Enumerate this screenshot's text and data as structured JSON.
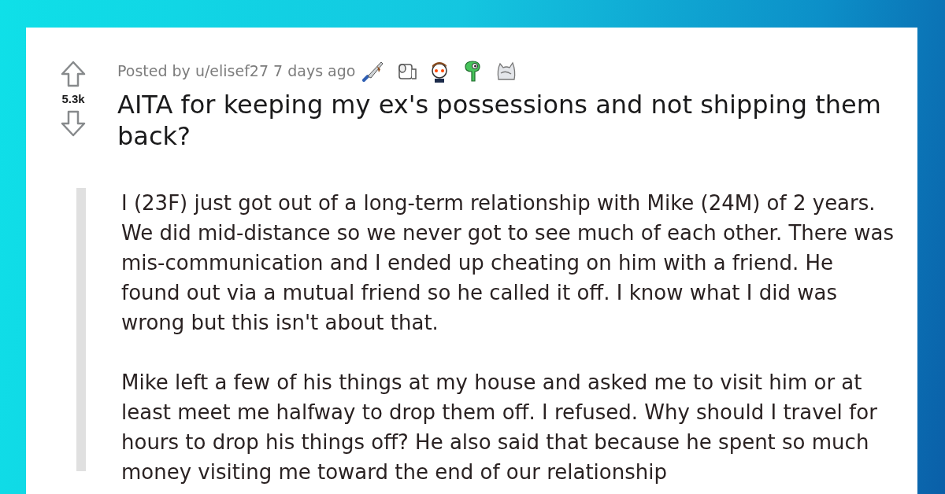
{
  "post": {
    "score": "5.3k",
    "meta": "Posted by u/elisef27 7 days ago",
    "awards": [
      {
        "kind": "knife"
      },
      {
        "kind": "paper"
      },
      {
        "kind": "face"
      },
      {
        "kind": "dino"
      },
      {
        "kind": "cat"
      }
    ],
    "title": "AITA for keeping my ex's possessions and not shipping them back?",
    "paragraphs": [
      "I (23F) just got out of a long-term relationship with Mike (24M) of 2 years. We did mid-distance so we never got to see much of each other. There was mis-communication and I ended up cheating on him with a friend. He found out via a mutual friend so he called it off. I know what I did was wrong but this isn't about that.",
      "Mike left a few of his things at my house and asked me to visit him or at least meet me halfway to drop them off. I refused. Why should I travel for hours to drop his things off? He also said that because he spent so much money visiting me toward the end of our relationship"
    ]
  }
}
